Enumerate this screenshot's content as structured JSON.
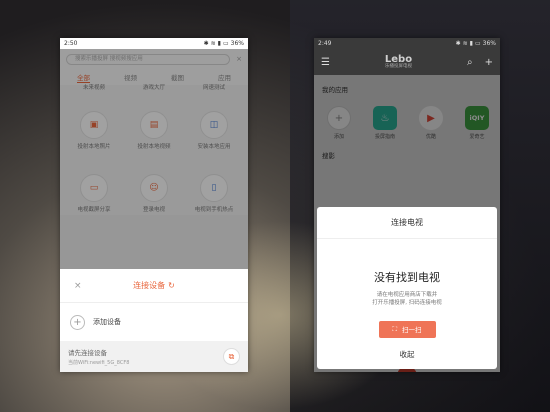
{
  "left_phone": {
    "status": {
      "time": "2:50",
      "battery": "36%"
    },
    "search": {
      "placeholder": "搜索乐播投屏 搜视频搜应用",
      "close": "×"
    },
    "tabs": [
      {
        "label": "全部",
        "active": true
      },
      {
        "label": "视频",
        "active": false
      },
      {
        "label": "截图",
        "active": false
      },
      {
        "label": "应用",
        "active": false
      }
    ],
    "grid": [
      {
        "label": "未来视频",
        "icon": "tv-icon"
      },
      {
        "label": "游戏大厅",
        "icon": "gamepad-icon"
      },
      {
        "label": "网速测试",
        "icon": "speed-icon"
      },
      {
        "label": "投射本地照片",
        "icon": "photo-icon"
      },
      {
        "label": "投射本地视频",
        "icon": "video-icon"
      },
      {
        "label": "安装本地应用",
        "icon": "install-icon"
      },
      {
        "label": "电视截屏分享",
        "icon": "screenshot-icon"
      },
      {
        "label": "登录电视",
        "icon": "user-icon"
      },
      {
        "label": "电视到手机热点",
        "icon": "hotspot-icon"
      }
    ],
    "sheet": {
      "title": "连接设备",
      "add_device": "添加设备",
      "prompt": "请先连接设备",
      "wifi": "当前WiFi:newifi_5G_8CF8"
    }
  },
  "right_phone": {
    "status": {
      "time": "2:49",
      "battery": "36%"
    },
    "logo": {
      "main": "Lebo",
      "sub": "乐播投屏电视"
    },
    "my_apps_title": "我的应用",
    "apps": [
      {
        "label": "添加",
        "icon": "plus-icon",
        "style": "add"
      },
      {
        "label": "投屏指南",
        "icon": "lightbulb-icon",
        "style": "teal"
      },
      {
        "label": "优酷",
        "icon": "youku-icon",
        "style": "white"
      },
      {
        "label": "爱奇艺",
        "icon": "iqiyi-icon",
        "style": "green",
        "glyph": "iQIY"
      }
    ],
    "section2_title": "搜影",
    "dialog": {
      "title": "连接电视",
      "heading": "没有找到电视",
      "desc_line1": "请在电视应用商店下载并",
      "desc_line2": "打开乐播投屏, 扫码连接电视",
      "scan_button": "扫一扫"
    },
    "collapse": "收起"
  },
  "colors": {
    "accent": "#e8663d",
    "button": "#ef7457"
  }
}
